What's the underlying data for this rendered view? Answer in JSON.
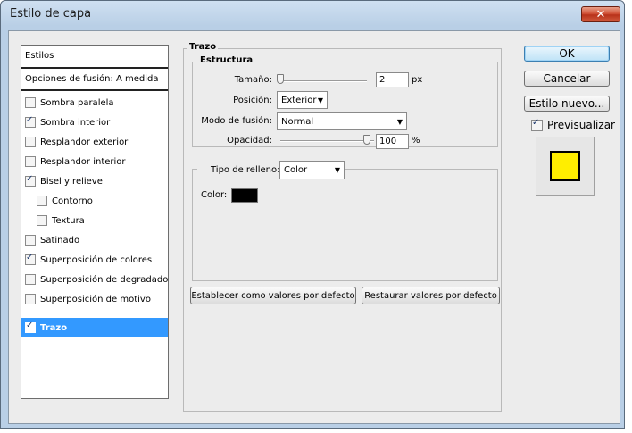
{
  "window": {
    "title": "Estilo de capa",
    "close_label": "✕"
  },
  "styles_panel": {
    "header": "Estilos",
    "blend_options": "Opciones de fusión: A medida",
    "items": [
      {
        "label": "Sombra paralela",
        "checked": false
      },
      {
        "label": "Sombra interior",
        "checked": true
      },
      {
        "label": "Resplandor exterior",
        "checked": false
      },
      {
        "label": "Resplandor interior",
        "checked": false
      },
      {
        "label": "Bisel y relieve",
        "checked": true
      },
      {
        "label": "Contorno",
        "checked": false
      },
      {
        "label": "Textura",
        "checked": false
      },
      {
        "label": "Satinado",
        "checked": false
      },
      {
        "label": "Superposición de colores",
        "checked": true
      },
      {
        "label": "Superposición de degradado",
        "checked": false
      },
      {
        "label": "Superposición de motivo",
        "checked": false
      },
      {
        "label": "Trazo",
        "checked": true,
        "selected": true
      }
    ]
  },
  "trazo": {
    "group_title": "Trazo",
    "estructura": {
      "title": "Estructura",
      "size_label": "Tamaño:",
      "size_value": "2",
      "size_unit": "px",
      "position_label": "Posición:",
      "position_value": "Exterior",
      "blend_mode_label": "Modo de fusión:",
      "blend_mode_value": "Normal",
      "opacity_label": "Opacidad:",
      "opacity_value": "100",
      "opacity_unit": "%"
    },
    "fill": {
      "type_label": "Tipo de relleno:",
      "type_value": "Color",
      "color_label": "Color:",
      "color_value": "#000000"
    },
    "default_button": "Establecer como valores por defecto",
    "restore_button": "Restaurar valores por defecto"
  },
  "actions": {
    "ok": "OK",
    "cancel": "Cancelar",
    "new_style": "Estilo nuevo...",
    "preview_label": "Previsualizar",
    "preview_checked": true
  },
  "colors": {
    "preview_fill": "#ffee00",
    "selected_row": "#3399ff"
  }
}
